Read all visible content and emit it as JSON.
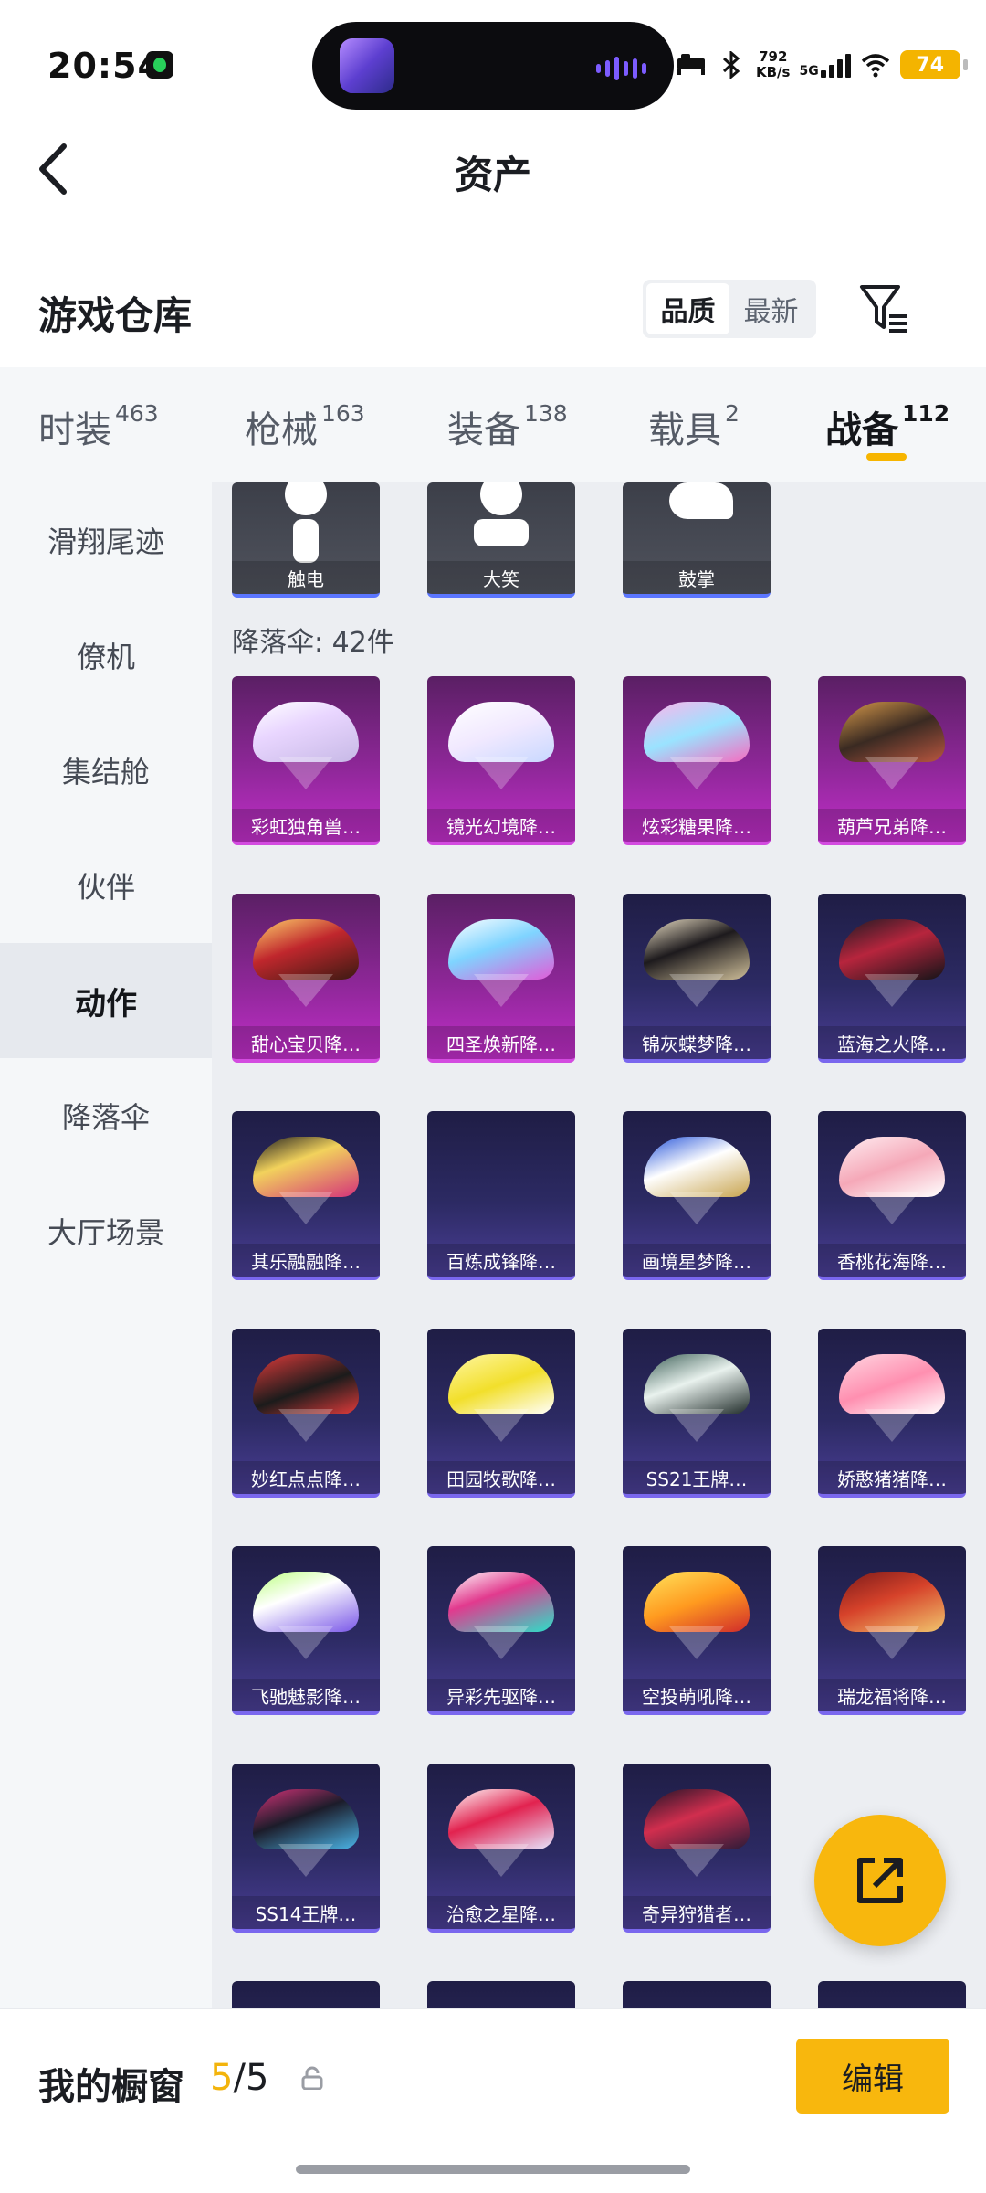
{
  "status_bar": {
    "time": "20:54",
    "net_speed_value": "792",
    "net_speed_unit": "KB/s",
    "network_type": "5G",
    "battery": "74"
  },
  "header": {
    "title": "资产"
  },
  "warehouse": {
    "title": "游戏仓库",
    "sort_options": [
      "品质",
      "最新"
    ],
    "sort_selected": "品质"
  },
  "tabs": [
    {
      "label": "时装",
      "count": "463"
    },
    {
      "label": "枪械",
      "count": "163"
    },
    {
      "label": "装备",
      "count": "138"
    },
    {
      "label": "载具",
      "count": "2"
    },
    {
      "label": "战备",
      "count": "112"
    }
  ],
  "active_tab": "战备",
  "sidebar": {
    "items": [
      "滑翔尾迹",
      "僚机",
      "集结舱",
      "伙伴",
      "动作",
      "降落伞",
      "大厅场景"
    ],
    "active": "动作"
  },
  "emotes": [
    "触电",
    "大笑",
    "鼓掌"
  ],
  "parachutes": {
    "header": "降落伞: 42件",
    "items": [
      "彩虹独角兽…",
      "镜光幻境降…",
      "炫彩糖果降…",
      "葫芦兄弟降…",
      "甜心宝贝降…",
      "四圣焕新降…",
      "锦灰蝶梦降…",
      "蓝海之火降…",
      "其乐融融降…",
      "百炼成锋降…",
      "画境星梦降…",
      "香桃花海降…",
      "妙红点点降…",
      "田园牧歌降…",
      "SS21王牌…",
      "娇憨猪猪降…",
      "飞驰魅影降…",
      "异彩先驱降…",
      "空投萌吼降…",
      "瑞龙福将降…",
      "SS14王牌…",
      "治愈之星降…",
      "奇异狩猎者…"
    ]
  },
  "showcase": {
    "label": "我的橱窗",
    "current": "5",
    "separator": "/",
    "total": "5",
    "edit_label": "编辑"
  },
  "colors": {
    "accent": "#f8b70d",
    "legendary_card": "#c12fc9",
    "epic_card": "#4a3e95"
  }
}
